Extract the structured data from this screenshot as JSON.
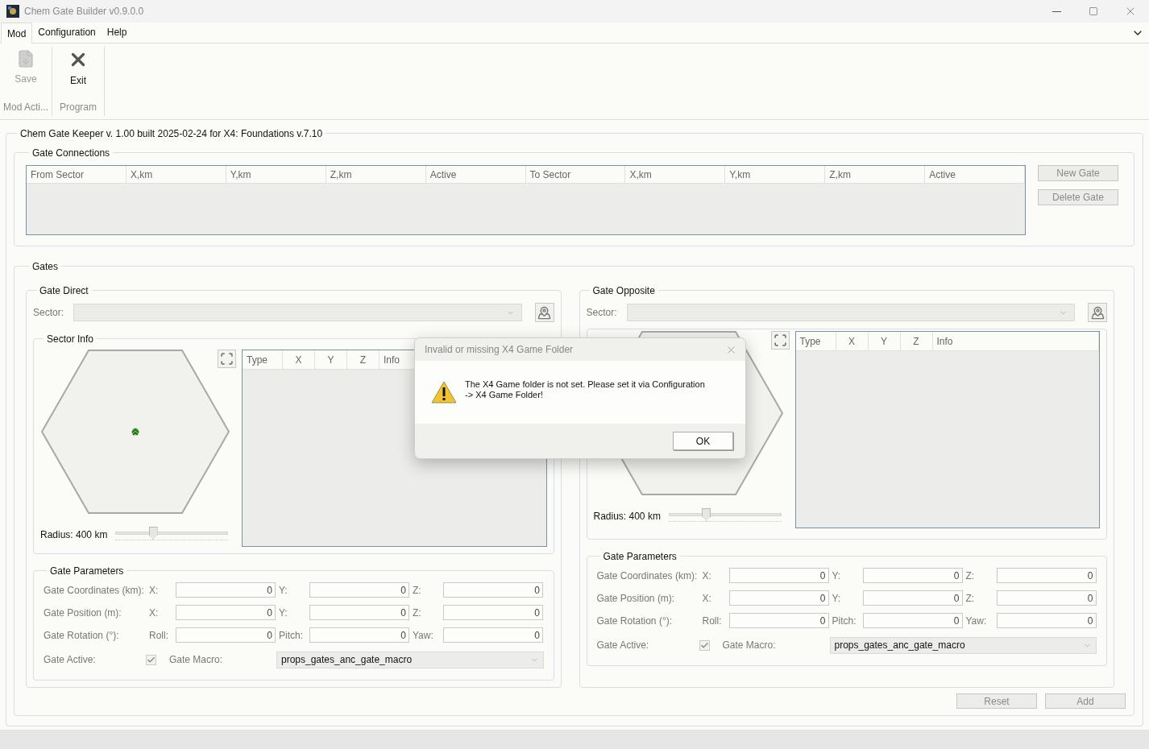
{
  "window": {
    "title": "Chem Gate Builder v0.9.0.0"
  },
  "ribbon_tabs": [
    {
      "label": "Mod",
      "selected": true
    },
    {
      "label": "Configuration",
      "selected": false
    },
    {
      "label": "Help",
      "selected": false
    }
  ],
  "ribbon_groups": [
    {
      "label": "Mod Acti...",
      "buttons": [
        {
          "label": "Save",
          "kind": "save",
          "disabled": true
        }
      ]
    },
    {
      "label": "Program",
      "buttons": [
        {
          "label": "Exit",
          "kind": "exit",
          "disabled": false
        }
      ]
    }
  ],
  "main_group": {
    "title": "Chem Gate Keeper v. 1.00 built 2025-02-24 for X4: Foundations v.7.10"
  },
  "gate_connections": {
    "title": "Gate Connections",
    "columns": [
      "From Sector",
      "X,km",
      "Y,km",
      "Z,km",
      "Active",
      "To Sector",
      "X,km",
      "Y,km",
      "Z,km",
      "Active"
    ],
    "buttons": [
      "New Gate",
      "Delete Gate"
    ]
  },
  "gates": {
    "title": "Gates",
    "panels": [
      {
        "title": "Gate Direct",
        "sector_label": "Sector:",
        "sector_info_title": "Sector Info",
        "radius_label": "Radius: 400 km",
        "radius_slider": {
          "level": 0.33
        },
        "columns": [
          "Type",
          "X",
          "Y",
          "Z",
          "Info"
        ],
        "parameters": {
          "title": "Gate Parameters",
          "rows": [
            {
              "label": "Gate Coordinates (km):",
              "fields": [
                {
                  "label": "X:",
                  "value": "0"
                },
                {
                  "label": "Y:",
                  "value": "0"
                },
                {
                  "label": "Z:",
                  "value": "0"
                }
              ]
            },
            {
              "label": "Gate Position (m):",
              "fields": [
                {
                  "label": "X:",
                  "value": "0"
                },
                {
                  "label": "Y:",
                  "value": "0"
                },
                {
                  "label": "Z:",
                  "value": "0"
                }
              ]
            },
            {
              "label": "Gate Rotation (°):",
              "fields": [
                {
                  "label": "Roll:",
                  "value": "0"
                },
                {
                  "label": "Pitch:",
                  "value": "0"
                },
                {
                  "label": "Yaw:",
                  "value": "0"
                }
              ]
            }
          ],
          "active_label": "Gate Active:",
          "active_checked": true,
          "macro_label": "Gate Macro:",
          "macro_value": "props_gates_anc_gate_macro"
        }
      },
      {
        "title": "Gate Opposite",
        "sector_label": "Sector:",
        "radius_label": "Radius: 400 km",
        "radius_slider": {
          "level": 0.33
        },
        "columns": [
          "Type",
          "X",
          "Y",
          "Z",
          "Info"
        ],
        "parameters": {
          "title": "Gate Parameters",
          "rows": [
            {
              "label": "Gate Coordinates (km):",
              "fields": [
                {
                  "label": "X:",
                  "value": "0"
                },
                {
                  "label": "Y:",
                  "value": "0"
                },
                {
                  "label": "Z:",
                  "value": "0"
                }
              ]
            },
            {
              "label": "Gate Position (m):",
              "fields": [
                {
                  "label": "X:",
                  "value": "0"
                },
                {
                  "label": "Y:",
                  "value": "0"
                },
                {
                  "label": "Z:",
                  "value": "0"
                }
              ]
            },
            {
              "label": "Gate Rotation (°):",
              "fields": [
                {
                  "label": "Roll:",
                  "value": "0"
                },
                {
                  "label": "Pitch:",
                  "value": "0"
                },
                {
                  "label": "Yaw:",
                  "value": "0"
                }
              ]
            }
          ],
          "active_label": "Gate Active:",
          "active_checked": true,
          "macro_label": "Gate Macro:",
          "macro_value": "props_gates_anc_gate_macro"
        }
      }
    ]
  },
  "footer_buttons": [
    "Reset",
    "Add"
  ],
  "dialog": {
    "title": "Invalid or missing X4 Game Folder",
    "message_lines": [
      "The X4 Game folder is not set. Please set it via Configuration",
      "-> X4 Game Folder!"
    ],
    "button": "OK"
  }
}
